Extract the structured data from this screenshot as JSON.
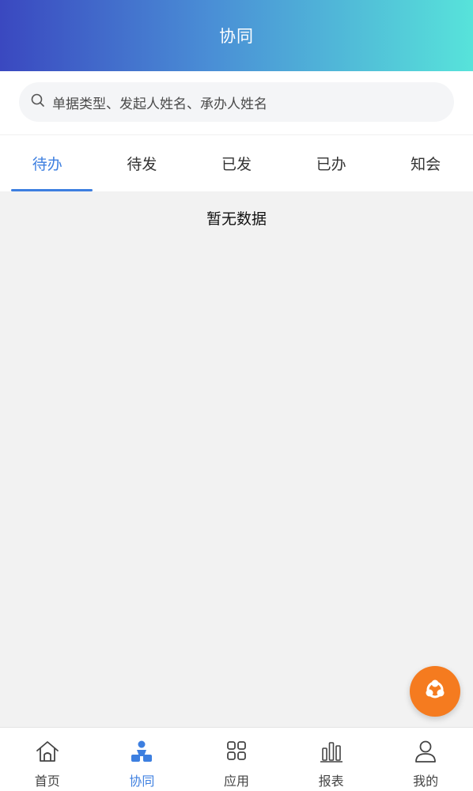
{
  "header": {
    "title": "协同"
  },
  "search": {
    "placeholder": "单据类型、发起人姓名、承办人姓名"
  },
  "tabs": [
    {
      "label": "待办",
      "active": true
    },
    {
      "label": "待发",
      "active": false
    },
    {
      "label": "已发",
      "active": false
    },
    {
      "label": "已办",
      "active": false
    },
    {
      "label": "知会",
      "active": false
    }
  ],
  "content": {
    "empty_text": "暂无数据"
  },
  "bottom_nav": [
    {
      "label": "首页",
      "icon": "home-icon",
      "active": false
    },
    {
      "label": "协同",
      "icon": "collaboration-icon",
      "active": true
    },
    {
      "label": "应用",
      "icon": "apps-grid-icon",
      "active": false
    },
    {
      "label": "报表",
      "icon": "bar-chart-icon",
      "active": false
    },
    {
      "label": "我的",
      "icon": "user-icon",
      "active": false
    }
  ],
  "colors": {
    "accent": "#3d7fe0",
    "header_gradient_start": "#3a48c0",
    "header_gradient_end": "#57e3da",
    "fab": "#f57b1f"
  }
}
